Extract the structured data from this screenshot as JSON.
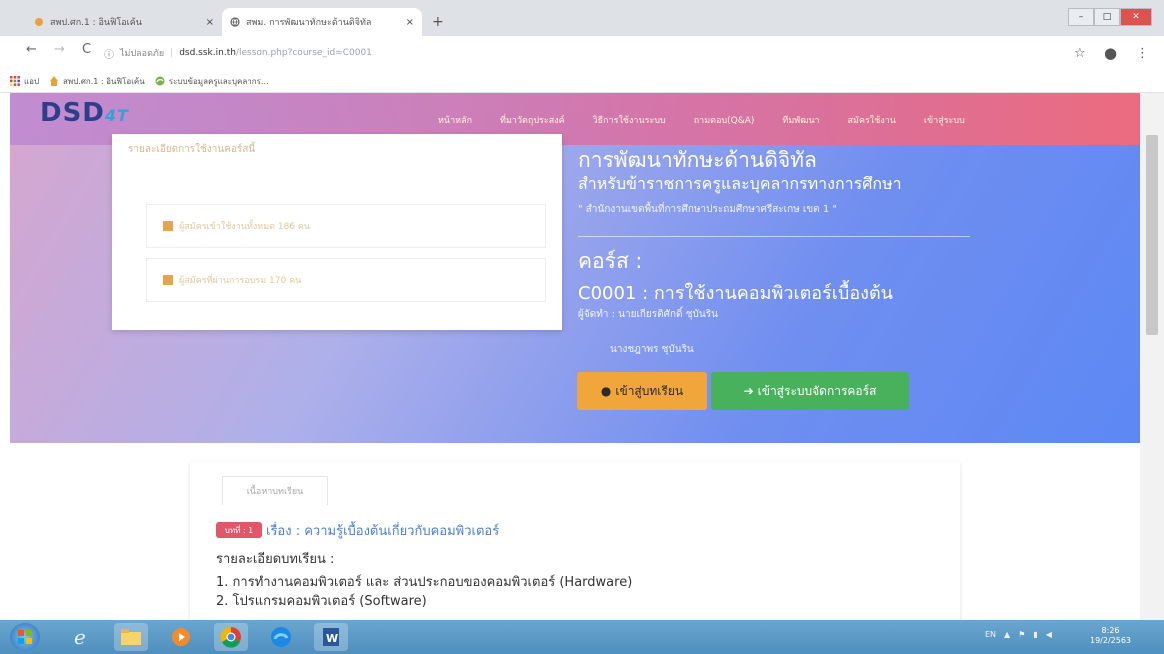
{
  "browser": {
    "tabs": [
      {
        "label": "สพป.ศก.1 : อินฟิโอเค้น",
        "close": "×"
      },
      {
        "label": "สพม. การพัฒนาทักษะด้านดิจิทัล",
        "close": "×"
      }
    ],
    "new_tab": "+",
    "nav": {
      "back": "←",
      "forward": "→",
      "reload": "C"
    },
    "address": {
      "security_label": "ไม่ปลอดภัย",
      "host": "dsd.ssk.in.th",
      "path": "/lesson.php?course_id=C0001"
    },
    "bookmarks": [
      {
        "label": "แอป",
        "icon": "apps-grid-icon"
      },
      {
        "label": "สพป.ศก.1 : อินฟิโอเค้น",
        "icon": "school-icon"
      },
      {
        "label": "ระบบข้อมูลครูและบุคลากร...",
        "icon": "edge-icon"
      }
    ],
    "window_controls": {
      "minimize": "–",
      "maximize": "□",
      "close": "✕"
    }
  },
  "site": {
    "logo": "DSD",
    "logo_sub": "4T",
    "nav": [
      "หน้าหลัก",
      "ที่มาวัตถุประสงค์",
      "วิธีการใช้งานระบบ",
      "ถามตอบ(Q&A)",
      "ทีมพัฒนา",
      "สมัครใช้งาน",
      "เข้าสู่ระบบ"
    ]
  },
  "stats_card": {
    "heading": "รายละเอียดการใช้งานคอร์สนี้",
    "items": [
      "ผู้สมัครเข้าใช้งานทั้งหมด 186 คน",
      "ผู้สมัครที่ผ่านการอบรม 170 คน"
    ]
  },
  "hero": {
    "title": "การพัฒนาทักษะด้านดิจิทัล",
    "subtitle": "สำหรับข้าราชการครูและบุคลากรทางการศึกษา",
    "agency": "\" สำนักงานเขตพื้นที่การศึกษาประถมศึกษาศรีสะเกษ เขต 1 \"",
    "course_label": "คอร์ส :",
    "course_name": "C0001 : การใช้งานคอมพิวเตอร์เบื้องต้น",
    "organizer_1": "ผู้จัดทำ : นายเกียรติศักดิ์ ชุบันริน",
    "organizer_2": "นางชฎาพร ชุบันริน",
    "btn_lessons": "เข้าสู่บทเรียน",
    "btn_manage": "เข้าสู่ระบบจัดการคอร์ส"
  },
  "lesson": {
    "tab": "เนื้อหาบทเรียน",
    "badge": "บทที่ : 1",
    "title": "เรื่อง : ความรู้เบื้องต้นเกี่ยวกับคอมพิวเตอร์",
    "detail_label": "รายละเอียดบทเรียน :",
    "items": [
      "1. การทำงานคอมพิวเตอร์ และ ส่วนประกอบของคอมพิวเตอร์ (Hardware)",
      "2. โปรแกรมคอมพิวเตอร์ (Software)"
    ]
  },
  "taskbar": {
    "tray_lang": "EN",
    "clock_time": "8:26",
    "clock_date": "19/2/2563"
  },
  "colors": {
    "nav_gradient_end": "#ec6b7f",
    "hero_blue": "#5d88f4",
    "btn_orange": "#f0a63b",
    "btn_green": "#47b15b",
    "badge_red": "#e0576a",
    "link_blue": "#4a7fd0"
  }
}
